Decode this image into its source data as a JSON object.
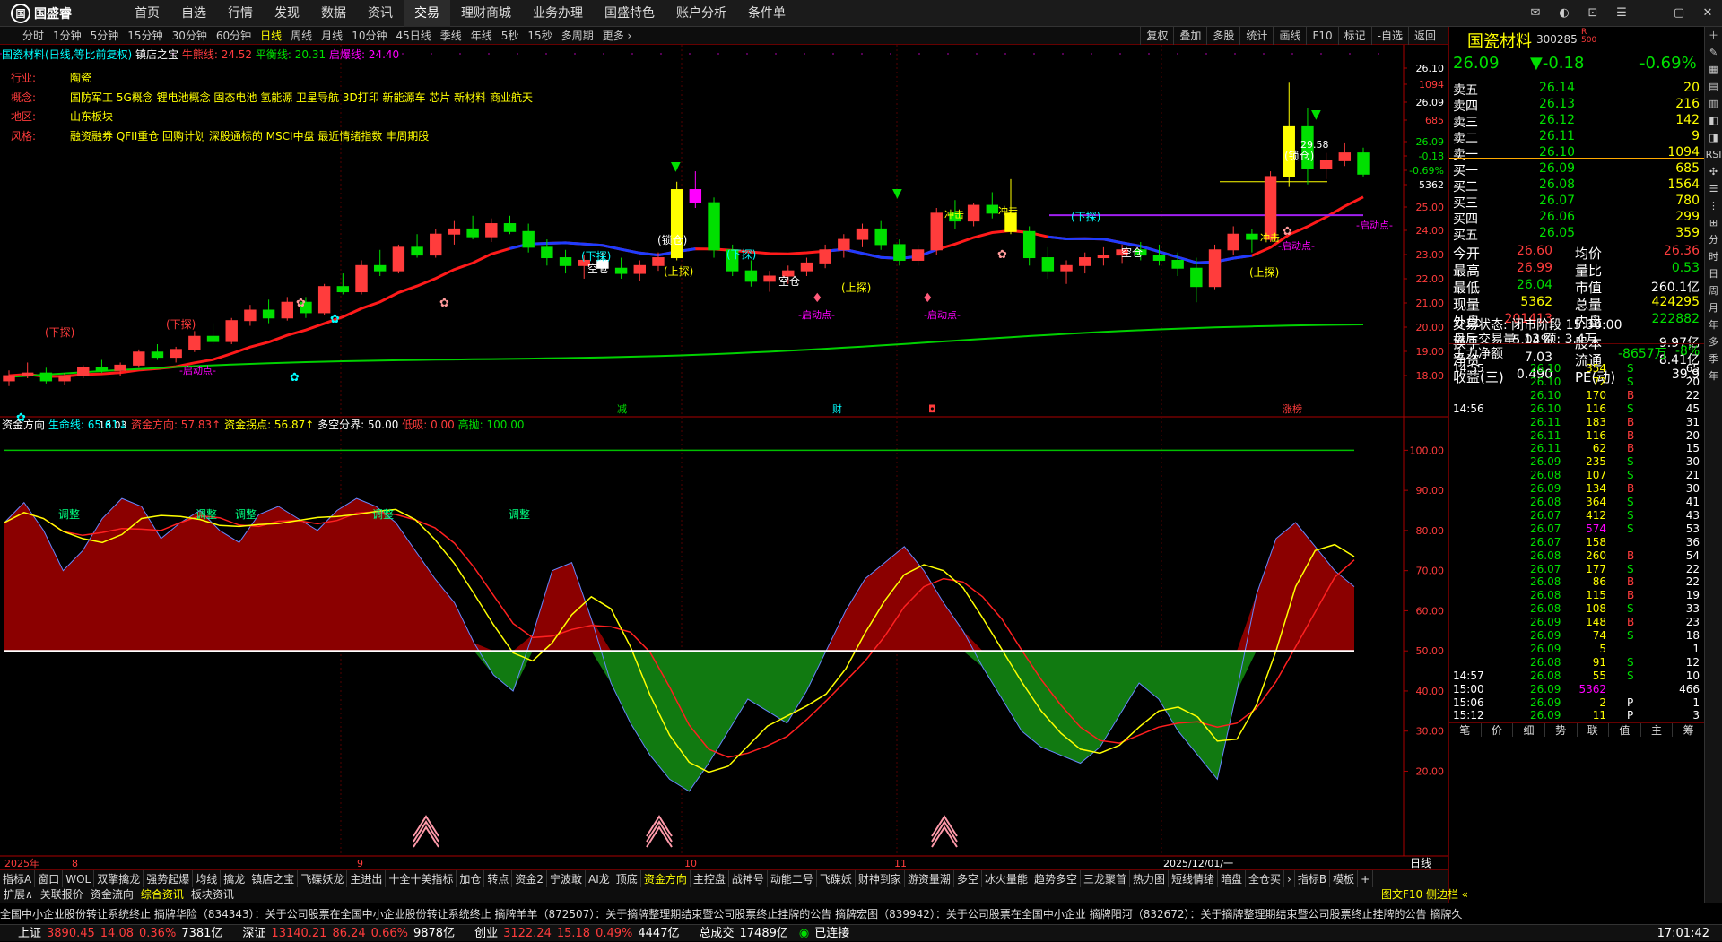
{
  "app": {
    "logo_text": "国盛睿",
    "logo_mark": "国"
  },
  "nav": [
    "首页",
    "自选",
    "行情",
    "发现",
    "数据",
    "资讯",
    "交易",
    "理财商城",
    "业务办理",
    "国盛特色",
    "账户分析",
    "条件单"
  ],
  "nav_active": "交易",
  "periods": [
    "分时",
    "1分钟",
    "5分钟",
    "15分钟",
    "30分钟",
    "60分钟",
    "日线",
    "周线",
    "月线",
    "10分钟",
    "45日线",
    "季线",
    "年线",
    "5秒",
    "15秒",
    "多周期",
    "更多 ›"
  ],
  "period_active": "日线",
  "chart_tools": [
    "复权",
    "叠加",
    "多股",
    "统计",
    "画线",
    "F10",
    "标记",
    "-自选",
    "返回"
  ],
  "kline_info": {
    "stock": "国瓷材料(日线,等比前复权)",
    "indicator": "镇店之宝",
    "l1": "牛熊线: 24.52",
    "l2": "平衡线: 20.31",
    "l3": "启爆线: 24.40"
  },
  "profile": [
    {
      "k": "行业:",
      "v": "陶瓷"
    },
    {
      "k": "概念:",
      "v": "国防军工 5G概念 锂电池概念 固态电池 氢能源 卫星导航 3D打印 新能源车 芯片 新材料 商业航天"
    },
    {
      "k": "地区:",
      "v": "山东板块"
    },
    {
      "k": "风格:",
      "v": "融资融券 QFII重仓 回购计划 深股通标的 MSCI中盘 最近情绪指数 丰周期股"
    }
  ],
  "price_axis": [
    "26.10",
    "1094",
    "26.09",
    "685",
    "26.09",
    "-0.18",
    "-0.69%",
    "5362",
    "25.00",
    "24.00",
    "23.00",
    "22.00",
    "21.00",
    "20.00",
    "19.00",
    "18.00"
  ],
  "chart_marks": {
    "high": "29.58",
    "low": "18.03",
    "start": "-启动点-",
    "breakdown": "(下探)",
    "up": "(上探)",
    "down_break": "(下探)",
    "empty": "空仓",
    "rebuy": "(锁仓)",
    "t_rise": "冲击"
  },
  "event_marks": [
    "减",
    "财",
    "◘",
    "涨榜"
  ],
  "fund_info": {
    "name": "资金方向",
    "l1": "生命线: 65.61↓",
    "l2": "资金方向: 57.83↑",
    "l3": "资金拐点: 56.87↑",
    "l4": "多空分界: 50.00",
    "l5": "低吸: 0.00",
    "l6": "高抛: 100.00"
  },
  "fund_axis": [
    "100.00",
    "90.00",
    "80.00",
    "70.00",
    "60.00",
    "50.00",
    "40.00",
    "30.00",
    "20.00"
  ],
  "fund_labels": [
    "调整",
    "调整",
    "调整",
    "调整",
    "调整"
  ],
  "dates": [
    "2025年",
    "8",
    "9",
    "10",
    "11",
    "2025/12/01/一"
  ],
  "date_end": "日线",
  "chart_data": {
    "type": "candlestick",
    "title": "国瓷材料(日线,等比前复权)",
    "range_high": 29.58,
    "range_low": 18.03,
    "ohlc": [
      [
        18.2,
        18.6,
        18.0,
        18.4
      ],
      [
        18.4,
        18.9,
        18.3,
        18.5
      ],
      [
        18.5,
        18.7,
        18.1,
        18.2
      ],
      [
        18.2,
        18.5,
        18.03,
        18.4
      ],
      [
        18.4,
        18.8,
        18.3,
        18.7
      ],
      [
        18.7,
        19.0,
        18.5,
        18.6
      ],
      [
        18.6,
        18.9,
        18.4,
        18.8
      ],
      [
        18.8,
        19.4,
        18.7,
        19.3
      ],
      [
        19.3,
        19.6,
        19.0,
        19.1
      ],
      [
        19.1,
        19.5,
        18.9,
        19.4
      ],
      [
        19.4,
        20.1,
        19.3,
        19.9
      ],
      [
        19.9,
        20.4,
        19.6,
        19.7
      ],
      [
        19.7,
        20.6,
        19.6,
        20.5
      ],
      [
        20.5,
        21.1,
        20.3,
        20.9
      ],
      [
        20.9,
        21.3,
        20.4,
        20.6
      ],
      [
        20.6,
        21.4,
        20.5,
        21.2
      ],
      [
        21.2,
        21.4,
        20.6,
        20.8
      ],
      [
        20.8,
        21.9,
        20.7,
        21.8
      ],
      [
        21.8,
        22.3,
        21.5,
        21.6
      ],
      [
        21.6,
        22.8,
        21.5,
        22.6
      ],
      [
        22.6,
        23.2,
        22.2,
        22.4
      ],
      [
        22.4,
        23.4,
        22.3,
        23.3
      ],
      [
        23.3,
        23.8,
        22.9,
        23.0
      ],
      [
        23.0,
        24.0,
        22.9,
        23.8
      ],
      [
        23.8,
        24.3,
        23.4,
        24.0
      ],
      [
        24.0,
        24.5,
        23.6,
        23.7
      ],
      [
        23.7,
        24.4,
        23.5,
        24.2
      ],
      [
        24.2,
        24.5,
        23.8,
        23.9
      ],
      [
        23.9,
        24.2,
        23.1,
        23.3
      ],
      [
        23.3,
        23.6,
        22.6,
        22.9
      ],
      [
        22.9,
        23.2,
        22.3,
        22.6
      ],
      [
        22.6,
        23.0,
        22.1,
        22.8
      ],
      [
        22.8,
        23.1,
        22.4,
        22.5
      ],
      [
        22.5,
        22.9,
        22.1,
        22.3
      ],
      [
        22.3,
        22.8,
        22.0,
        22.6
      ],
      [
        22.6,
        23.1,
        22.4,
        22.9
      ],
      [
        22.9,
        25.8,
        22.8,
        25.5
      ],
      [
        25.5,
        26.2,
        24.8,
        25.0
      ],
      [
        25.0,
        25.2,
        22.9,
        23.2
      ],
      [
        23.2,
        23.4,
        22.2,
        22.4
      ],
      [
        22.4,
        22.8,
        21.8,
        22.0
      ],
      [
        22.0,
        22.4,
        21.6,
        22.2
      ],
      [
        22.2,
        22.6,
        21.9,
        22.4
      ],
      [
        22.4,
        22.9,
        22.2,
        22.7
      ],
      [
        22.7,
        23.4,
        22.5,
        23.2
      ],
      [
        23.2,
        23.8,
        22.9,
        23.6
      ],
      [
        23.6,
        24.2,
        23.3,
        24.0
      ],
      [
        24.0,
        24.3,
        23.2,
        23.4
      ],
      [
        23.4,
        23.6,
        22.6,
        22.8
      ],
      [
        22.8,
        23.4,
        22.6,
        23.2
      ],
      [
        23.2,
        24.8,
        23.0,
        24.6
      ],
      [
        24.6,
        25.1,
        24.0,
        24.3
      ],
      [
        24.3,
        25.0,
        24.1,
        24.9
      ],
      [
        24.9,
        25.4,
        24.4,
        24.6
      ],
      [
        24.6,
        25.9,
        23.8,
        23.9
      ],
      [
        23.9,
        24.1,
        22.6,
        22.9
      ],
      [
        22.9,
        23.3,
        22.1,
        22.4
      ],
      [
        22.4,
        22.8,
        21.9,
        22.6
      ],
      [
        22.6,
        23.1,
        22.3,
        22.9
      ],
      [
        22.9,
        23.3,
        22.6,
        23.0
      ],
      [
        23.0,
        23.4,
        22.7,
        23.2
      ],
      [
        23.2,
        23.5,
        22.8,
        23.0
      ],
      [
        23.0,
        23.4,
        22.6,
        22.8
      ],
      [
        22.8,
        23.1,
        22.2,
        22.5
      ],
      [
        22.5,
        22.9,
        21.2,
        21.8
      ],
      [
        21.8,
        23.4,
        21.7,
        23.2
      ],
      [
        23.2,
        24.1,
        23.0,
        23.8
      ],
      [
        23.8,
        24.0,
        23.1,
        23.6
      ],
      [
        23.6,
        26.2,
        23.5,
        26.0
      ],
      [
        26.0,
        29.58,
        25.6,
        27.9
      ],
      [
        27.9,
        28.6,
        25.7,
        26.3
      ],
      [
        26.3,
        26.9,
        25.9,
        26.6
      ],
      [
        26.6,
        27.3,
        26.4,
        26.9
      ],
      [
        26.9,
        27.1,
        26.0,
        26.09
      ]
    ],
    "fund_direction": [
      82,
      87,
      80,
      70,
      75,
      83,
      88,
      86,
      78,
      82,
      85,
      80,
      77,
      84,
      86,
      83,
      80,
      85,
      88,
      86,
      82,
      75,
      68,
      62,
      52,
      44,
      40,
      54,
      70,
      72,
      58,
      42,
      32,
      24,
      18,
      15,
      22,
      30,
      38,
      35,
      32,
      40,
      50,
      60,
      68,
      72,
      76,
      70,
      62,
      55,
      46,
      38,
      30,
      26,
      24,
      22,
      26,
      34,
      42,
      38,
      30,
      24,
      18,
      40,
      64,
      78,
      82,
      76,
      70,
      66
    ],
    "lifeline_level": 65.61,
    "direction_level": 57.83,
    "turn_level": 56.87,
    "divide": 50,
    "low_buy": 0,
    "high_sell": 100
  },
  "quote": {
    "name": "国瓷材料",
    "code": "300285",
    "tag": "R 500",
    "price": "26.09",
    "change": "▼-0.18",
    "pct": "-0.69%"
  },
  "asks": [
    {
      "k": "卖五",
      "p": "26.14",
      "v": "20"
    },
    {
      "k": "卖四",
      "p": "26.13",
      "v": "216"
    },
    {
      "k": "卖三",
      "p": "26.12",
      "v": "142"
    },
    {
      "k": "卖二",
      "p": "26.11",
      "v": "9"
    },
    {
      "k": "卖一",
      "p": "26.10",
      "v": "1094"
    }
  ],
  "bids": [
    {
      "k": "买一",
      "p": "26.09",
      "v": "685"
    },
    {
      "k": "买二",
      "p": "26.08",
      "v": "1564"
    },
    {
      "k": "买三",
      "p": "26.07",
      "v": "780"
    },
    {
      "k": "买四",
      "p": "26.06",
      "v": "299"
    },
    {
      "k": "买五",
      "p": "26.05",
      "v": "359"
    }
  ],
  "stats": [
    [
      "今开",
      "26.60",
      "均价",
      "26.36"
    ],
    [
      "最高",
      "26.99",
      "量比",
      "0.53"
    ],
    [
      "最低",
      "26.04",
      "市值",
      "260.1亿"
    ],
    [
      "现量",
      "5362",
      "总量",
      "424295"
    ],
    [
      "外盘",
      "201413",
      "内盘",
      "222882"
    ],
    [
      "换手",
      "5.04%",
      "股本",
      "9.97亿"
    ],
    [
      "净资",
      "7.03",
      "流通",
      "8.41亿"
    ],
    [
      "收益(三)",
      "0.490",
      "PE(动)",
      "39.9"
    ]
  ],
  "trade_state": "交易状态: 闭市阶段 15:30:00",
  "after_hours": "盘后交易量: 13  额: 3.4万",
  "main_flow": {
    "label": "主力净额",
    "value": "-8657万",
    "pct": "-8%"
  },
  "ticks": [
    [
      "14:55",
      "26.10",
      "354",
      "S",
      "65"
    ],
    [
      "",
      "26.10",
      "72",
      "S",
      "20"
    ],
    [
      "",
      "26.10",
      "170",
      "B",
      "22"
    ],
    [
      "14:56",
      "26.10",
      "116",
      "S",
      "45"
    ],
    [
      "",
      "26.11",
      "183",
      "B",
      "31"
    ],
    [
      "",
      "26.11",
      "116",
      "B",
      "20"
    ],
    [
      "",
      "26.11",
      "62",
      "B",
      "15"
    ],
    [
      "",
      "26.09",
      "235",
      "S",
      "30"
    ],
    [
      "",
      "26.08",
      "107",
      "S",
      "21"
    ],
    [
      "",
      "26.09",
      "134",
      "B",
      "30"
    ],
    [
      "",
      "26.08",
      "364",
      "S",
      "41"
    ],
    [
      "",
      "26.07",
      "412",
      "S",
      "43"
    ],
    [
      "",
      "26.07",
      "574",
      "S",
      "53"
    ],
    [
      "",
      "26.07",
      "158",
      "",
      "36"
    ],
    [
      "",
      "26.08",
      "260",
      "B",
      "54"
    ],
    [
      "",
      "26.07",
      "177",
      "S",
      "22"
    ],
    [
      "",
      "26.08",
      "86",
      "B",
      "22"
    ],
    [
      "",
      "26.08",
      "115",
      "B",
      "19"
    ],
    [
      "",
      "26.08",
      "108",
      "S",
      "33"
    ],
    [
      "",
      "26.09",
      "148",
      "B",
      "23"
    ],
    [
      "",
      "26.09",
      "74",
      "S",
      "18"
    ],
    [
      "",
      "26.09",
      "5",
      "",
      "1"
    ],
    [
      "",
      "26.08",
      "91",
      "S",
      "12"
    ],
    [
      "14:57",
      "26.08",
      "55",
      "S",
      "10"
    ],
    [
      "15:00",
      "26.09",
      "5362",
      "",
      "466"
    ],
    [
      "15:06",
      "26.09",
      "2",
      "P",
      "1"
    ],
    [
      "15:12",
      "26.09",
      "11",
      "P",
      "3"
    ]
  ],
  "rp_tabs": [
    "笔",
    "价",
    "细",
    "势",
    "联",
    "值",
    "主",
    "筹"
  ],
  "side_tabs": [
    "＋",
    "✎",
    "▦",
    "▤",
    "▥",
    "◧",
    "◨",
    "RSI",
    "✣",
    "☰",
    "⋮",
    "⊞",
    "分",
    "时",
    "日",
    "周",
    "月",
    "年",
    "多",
    "季",
    "年"
  ],
  "ind_tabs": [
    "指标A",
    "窗口",
    "WOL",
    "双擎擒龙",
    "强势起爆",
    "均线",
    "擒龙",
    "镇店之宝",
    "飞碟妖龙",
    "主进出",
    "十全十美指标",
    "加仓",
    "转点",
    "资金2",
    "宁波敢",
    "AI龙",
    "顶底",
    "资金方向",
    "主控盘",
    "战神号",
    "动能二号",
    "飞碟妖",
    "财神到家",
    "游资量潮",
    "多空",
    "冰火量能",
    "趋势多空",
    "三龙聚首",
    "热力图",
    "短线情绪",
    "暗盘",
    "全仓买",
    "›",
    "指标B",
    "模板",
    "+"
  ],
  "ind_active": "资金方向",
  "sub_tabs": [
    "扩展∧",
    "关联报价",
    "资金流向",
    "综合资讯",
    "板块资讯"
  ],
  "right_bottom": "图文F10 侧边栏 «",
  "ticker": "全国中小企业股份转让系统终止      摘牌华险（834343）：关于公司股票在全国中小企业股份转让系统终止      摘牌羊羊（872507）：关于摘牌整理期结束暨公司股票终止挂牌的公告      摘牌宏图（839942）：关于公司股票在全国中小企业      摘牌阳河（832672）：关于摘牌整理期结束暨公司股票终止挂牌的公告      摘牌久",
  "status": [
    {
      "n": "上证",
      "v": "3890.45",
      "c": "14.08",
      "p": "0.36%",
      "a": "7381亿"
    },
    {
      "n": "深证",
      "v": "13140.21",
      "c": "86.24",
      "p": "0.66%",
      "a": "9878亿"
    },
    {
      "n": "创业",
      "v": "3122.24",
      "c": "15.18",
      "p": "0.49%",
      "a": "4447亿"
    }
  ],
  "total_label": "总成交",
  "total_value": "17489亿",
  "conn": "已连接",
  "clock": "17:01:42",
  "colors": {
    "up": "#ff3c3c",
    "down": "#00e000",
    "accent": "#ffff00",
    "bg": "#000000"
  }
}
